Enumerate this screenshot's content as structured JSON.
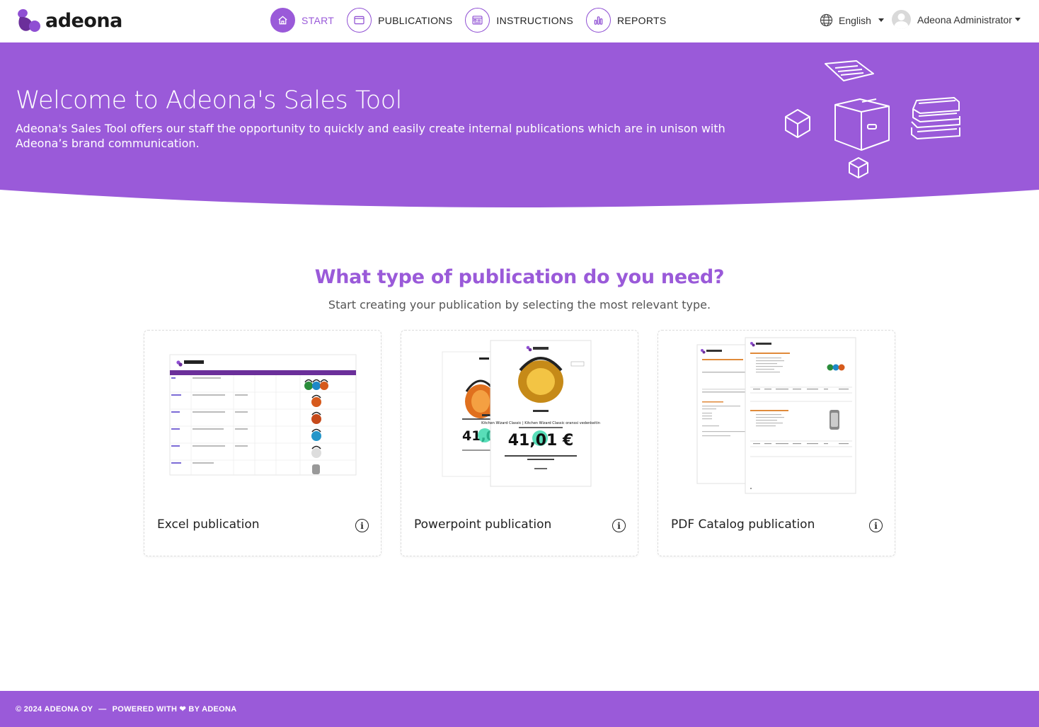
{
  "brand": {
    "name": "adeona",
    "accent": "#9a5ad9",
    "dark_accent": "#6b2f9a"
  },
  "nav": {
    "items": [
      {
        "label": "START",
        "icon": "home-icon",
        "active": true
      },
      {
        "label": "PUBLICATIONS",
        "icon": "window-icon",
        "active": false
      },
      {
        "label": "INSTRUCTIONS",
        "icon": "document-list-icon",
        "active": false
      },
      {
        "label": "REPORTS",
        "icon": "bar-chart-icon",
        "active": false
      }
    ]
  },
  "language": {
    "icon": "globe-icon",
    "label": "English"
  },
  "user": {
    "icon": "user-avatar",
    "label": "Adeona Administrator"
  },
  "hero": {
    "title": "Welcome to Adeona's Sales Tool",
    "description": "Adeona's Sales Tool offers our staff the opportunity to quickly and easily create internal publications which are in unison with Adeona’s brand communication."
  },
  "main": {
    "title": "What type of publication do you need?",
    "subtitle": "Start creating your publication by selecting the most relevant type.",
    "cards": [
      {
        "label": "Excel publication",
        "info_icon": "info-icon"
      },
      {
        "label": "Powerpoint publication",
        "info_icon": "info-icon",
        "preview_title": "Kitchen Wizard Classic | Kitchen Wizard Classic oranssi vedenkeitin",
        "preview_price": "41,01 €",
        "preview_price_partial": "41,0"
      },
      {
        "label": "PDF Catalog publication",
        "info_icon": "info-icon"
      }
    ]
  },
  "footer": {
    "copyright": "© 2024 ADEONA OY",
    "separator": "—",
    "powered": "POWERED WITH ❤ BY ADEONA"
  }
}
